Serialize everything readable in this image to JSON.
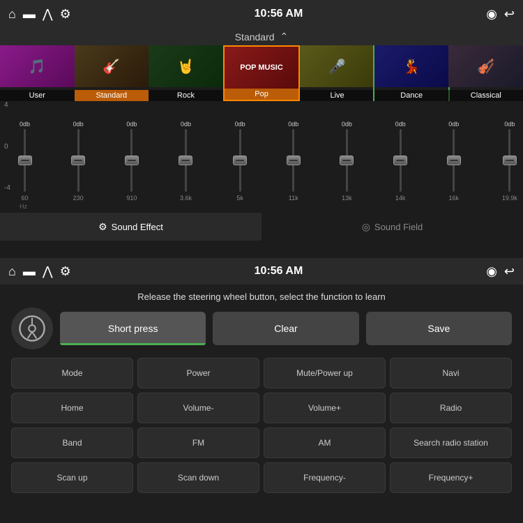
{
  "top": {
    "status": {
      "time": "10:56 AM"
    },
    "tabs_label": "Standard",
    "presets": [
      {
        "id": "user",
        "label": "User",
        "active": false
      },
      {
        "id": "standard",
        "label": "Standard",
        "active": true
      },
      {
        "id": "rock",
        "label": "Rock",
        "active": false
      },
      {
        "id": "pop",
        "label": "Pop",
        "active": false
      },
      {
        "id": "live",
        "label": "Live",
        "active": false
      },
      {
        "id": "dance",
        "label": "Dance",
        "active": false
      },
      {
        "id": "classical",
        "label": "Classical",
        "active": false
      }
    ],
    "eq": {
      "db_labels": [
        "0db",
        "0db",
        "0db",
        "0db",
        "0db",
        "0db",
        "0db",
        "0db",
        "0db",
        "0db"
      ],
      "freq_labels": [
        "60",
        "230",
        "910",
        "3.6k",
        "5k",
        "11k",
        "13k",
        "14k",
        "16k",
        "19.9k"
      ],
      "db_axis": [
        "4",
        "0",
        "-4"
      ],
      "hz_label": "Hz"
    },
    "bottom_tabs": [
      {
        "label": "Sound Effect",
        "active": true,
        "icon": "sliders"
      },
      {
        "label": "Sound Field",
        "active": false,
        "icon": "circle"
      }
    ]
  },
  "bottom": {
    "status": {
      "time": "10:56 AM"
    },
    "instruction": "Release the steering wheel button, select the function to learn",
    "controls": {
      "short_press": "Short press",
      "clear": "Clear",
      "save": "Save"
    },
    "functions": [
      "Mode",
      "Power",
      "Mute/Power up",
      "Navi",
      "Home",
      "Volume-",
      "Volume+",
      "Radio",
      "Band",
      "FM",
      "AM",
      "Search radio station",
      "Scan up",
      "Scan down",
      "Frequency-",
      "Frequency+"
    ]
  }
}
